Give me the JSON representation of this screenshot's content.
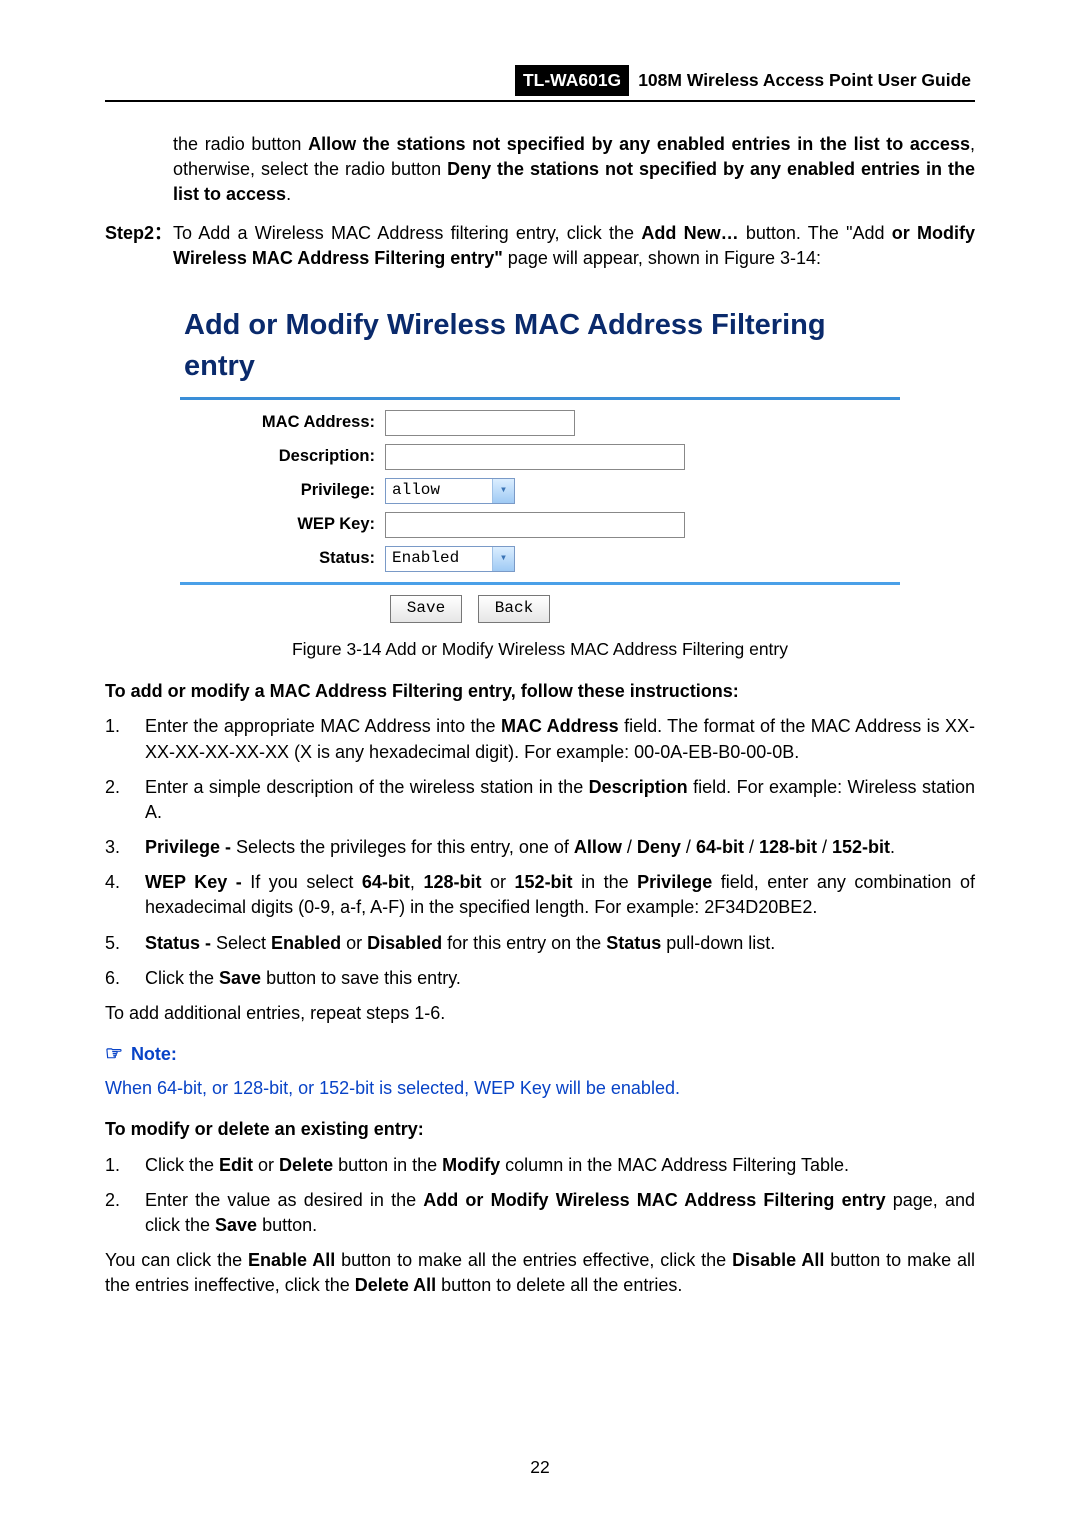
{
  "header": {
    "model": "TL-WA601G",
    "guide": "108M Wireless Access Point User Guide"
  },
  "tail_para": {
    "t1": "the radio button ",
    "b1": "Allow the stations not specified by any enabled entries in the list to access",
    "t2": ", otherwise, select the radio button ",
    "b2": "Deny the stations not specified by any enabled entries in the list to access",
    "t3": "."
  },
  "step2": {
    "label": "Step2：",
    "t1": "To Add a Wireless MAC Address filtering entry, click the ",
    "b1": "Add New…",
    "t2": " button. The \"Add ",
    "b2": "or Modify Wireless MAC Address Filtering entry\"",
    "t3": " page will appear, shown in Figure 3-14:"
  },
  "figure": {
    "title": "Add or Modify Wireless MAC Address Filtering entry",
    "labels": {
      "mac": "MAC Address:",
      "desc": "Description:",
      "priv": "Privilege:",
      "wep": "WEP Key:",
      "status": "Status:"
    },
    "values": {
      "priv": "allow",
      "status": "Enabled"
    },
    "buttons": {
      "save": "Save",
      "back": "Back"
    },
    "caption": "Figure 3-14 Add or Modify Wireless MAC Address Filtering entry"
  },
  "instr_head": "To add or modify a MAC Address Filtering entry, follow these instructions:",
  "list1": {
    "i1": {
      "n": "1.",
      "t1": "Enter the appropriate MAC Address into the ",
      "b1": "MAC Address",
      "t2": " field. The format of the MAC Address is XX-XX-XX-XX-XX-XX (X is any hexadecimal digit). For example: 00-0A-EB-B0-00-0B."
    },
    "i2": {
      "n": "2.",
      "t1": "Enter a simple description of the wireless station in the ",
      "b1": "Description",
      "t2": " field. For example: Wireless station A."
    },
    "i3": {
      "n": "3.",
      "b1": "Privilege - ",
      "t1": "Selects the privileges for this entry, one of ",
      "b2": "Allow",
      "s1": " / ",
      "b3": "Deny",
      "s2": " / ",
      "b4": "64-bit",
      "s3": " / ",
      "b5": "128-bit",
      "s4": " / ",
      "b6": "152-bit",
      "t2": "."
    },
    "i4": {
      "n": "4.",
      "b1": "WEP Key - ",
      "t1": "If you select ",
      "b2": "64-bit",
      "c1": ", ",
      "b3": "128-bit",
      "t2": " or ",
      "b4": "152-bit",
      "t3": " in the ",
      "b5": "Privilege",
      "t4": " field, enter any combination of hexadecimal digits (0-9, a-f, A-F) in the specified length. For example: 2F34D20BE2."
    },
    "i5": {
      "n": "5.",
      "b1": "Status - ",
      "t1": "Select ",
      "b2": "Enabled",
      "t2": " or ",
      "b3": "Disabled",
      "t3": " for this entry on the ",
      "b4": "Status",
      "t4": " pull-down list."
    },
    "i6": {
      "n": "6.",
      "t1": "Click the ",
      "b1": "Save",
      "t2": " button to save this entry."
    }
  },
  "repeat": "To add additional entries, repeat steps 1-6.",
  "note": {
    "hand": "☞",
    "head": "Note:",
    "body": "When 64-bit, or 128-bit, or 152-bit is selected, WEP Key will be enabled."
  },
  "mod_head": "To modify or delete an existing entry:",
  "list2": {
    "i1": {
      "n": "1.",
      "t1": "Click the ",
      "b1": "Edit",
      "t2": " or ",
      "b2": "Delete",
      "t3": " button in the ",
      "b3": "Modify",
      "t4": " column in the MAC Address Filtering Table."
    },
    "i2": {
      "n": "2.",
      "t1": "Enter the value as desired in the ",
      "b1": "Add or Modify Wireless MAC Address Filtering entry",
      "t2": " page, and click the ",
      "b2": "Save",
      "t3": " button."
    }
  },
  "closing": {
    "t1": "You can click the ",
    "b1": "Enable All",
    "t2": " button to make all the entries effective, click the ",
    "b2": "Disable All",
    "t3": " button to make all the entries ineffective, click the ",
    "b3": "Delete All",
    "t4": " button to delete all the entries."
  },
  "page_num": "22"
}
